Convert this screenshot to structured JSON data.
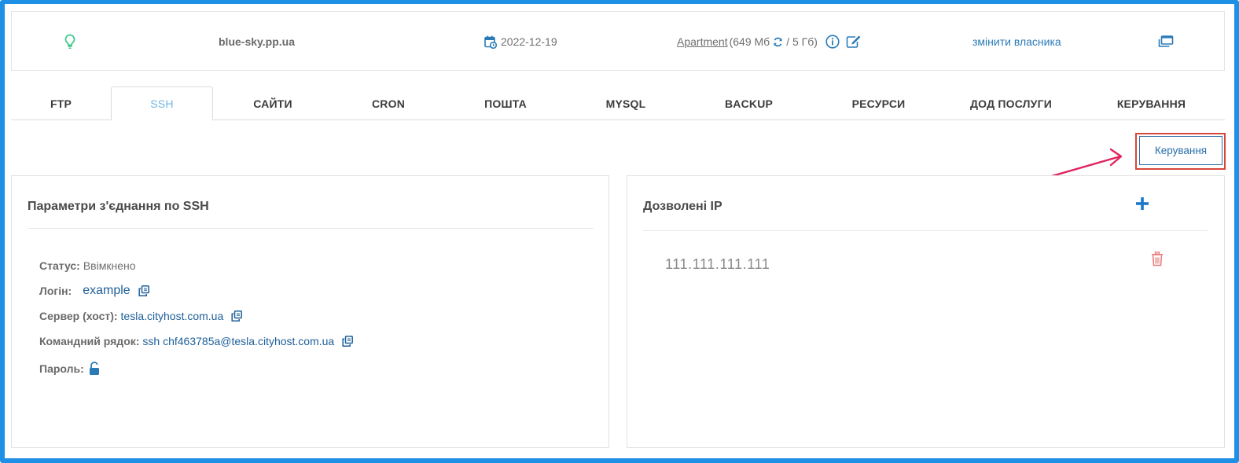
{
  "infobar": {
    "domain": "blue-sky.pp.ua",
    "date": "2022-12-19",
    "plan_name": "Apartment",
    "plan_usage_open": "(649 Мб",
    "plan_usage_close": "/ 5 Гб)",
    "change_owner": "змінити власника"
  },
  "tabs": [
    {
      "label": "FTP"
    },
    {
      "label": "SSH"
    },
    {
      "label": "САЙТИ"
    },
    {
      "label": "CRON"
    },
    {
      "label": "ПОШТА"
    },
    {
      "label": "MYSQL"
    },
    {
      "label": "BACKUP"
    },
    {
      "label": "РЕСУРСИ"
    },
    {
      "label": "ДОД ПОСЛУГИ"
    },
    {
      "label": "КЕРУВАННЯ"
    }
  ],
  "active_tab": "SSH",
  "manage_button": "Керування",
  "ssh_panel": {
    "title": "Параметри з'єднання по SSH",
    "status_label": "Статус:",
    "status_value": "Ввімкнено",
    "login_label": "Логін:",
    "login_value": "example",
    "server_label": "Сервер (хост):",
    "server_value": "tesla.cityhost.com.ua",
    "cmd_label": "Командний рядок:",
    "cmd_value": "ssh chf463785a@tesla.cityhost.com.ua",
    "password_label": "Пароль:"
  },
  "ip_panel": {
    "title": "Дозволені IP",
    "ips": [
      "111.111.111.111"
    ]
  },
  "colors": {
    "frame": "#1e90e6",
    "link": "#1e5f99",
    "active_tab": "#6fb6e6",
    "highlight": "#d9463a",
    "arrow": "#e0245e",
    "bulb": "#3cc88a",
    "trash": "#e87f7f"
  },
  "icons": [
    "lightbulb-icon",
    "calendar-icon",
    "refresh-icon",
    "info-icon",
    "edit-icon",
    "windows-icon",
    "copy-icon",
    "unlock-icon",
    "plus-icon",
    "trash-icon",
    "arrow-annotation"
  ]
}
